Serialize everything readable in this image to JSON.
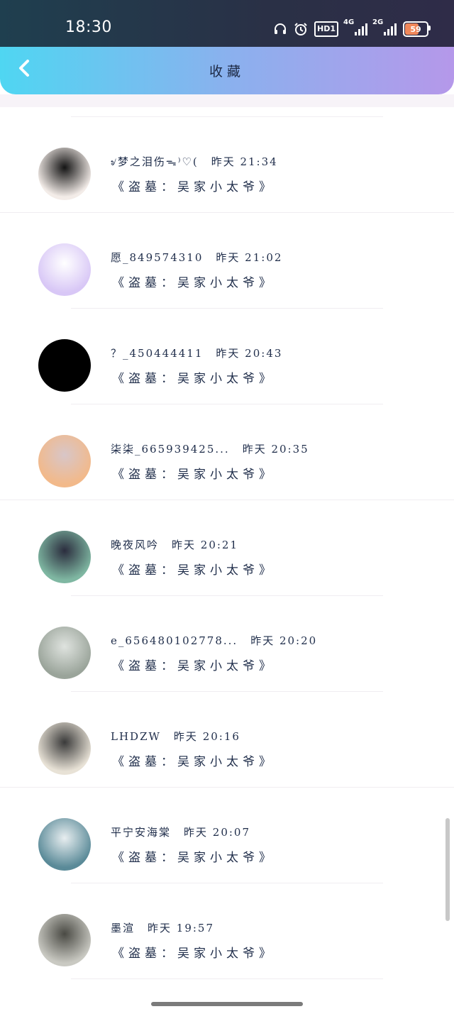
{
  "status_bar": {
    "time": "18:30",
    "icons": [
      "headphones-icon",
      "alarm-icon",
      "hd-icon",
      "signal-4g-icon",
      "signal-2g-icon",
      "battery-icon"
    ],
    "hd_label": "HD1",
    "net1_label": "4G",
    "net2_label": "2G",
    "battery_level": "59"
  },
  "header": {
    "title": "收藏",
    "back_icon": "chevron-left-icon"
  },
  "list": {
    "items": [
      {
        "name": "৶梦之泪伤ᯓ⁾♡(",
        "time": "昨天 21:34",
        "content": "《盗墓：吴家小太爷》",
        "avatar_colors": [
          "#f3ece8",
          "#141414"
        ]
      },
      {
        "name": "愿_849574310",
        "time": "昨天 21:02",
        "content": "《盗墓：吴家小太爷》",
        "avatar_colors": [
          "#d8c7f6",
          "#ffffff"
        ]
      },
      {
        "name": "？_450444411",
        "time": "昨天 20:43",
        "content": "《盗墓：吴家小太爷》",
        "avatar_colors": [
          "#000000",
          "#000000"
        ]
      },
      {
        "name": "柒柒_665939425...",
        "time": "昨天 20:35",
        "content": "《盗墓：吴家小太爷》",
        "avatar_colors": [
          "#f2b98a",
          "#d8c6c8"
        ]
      },
      {
        "name": "晚夜风吟",
        "time": "昨天 20:21",
        "content": "《盗墓：吴家小太爷》",
        "avatar_colors": [
          "#7fb7a2",
          "#2b2d3e"
        ]
      },
      {
        "name": "e_656480102778...",
        "time": "昨天 20:20",
        "content": "《盗墓：吴家小太爷》",
        "avatar_colors": [
          "#9aa49a",
          "#dfe3df"
        ]
      },
      {
        "name": "LHDZW",
        "time": "昨天 20:16",
        "content": "《盗墓：吴家小太爷》",
        "avatar_colors": [
          "#e8e2d6",
          "#3a3a3a"
        ]
      },
      {
        "name": "平宁安海棠",
        "time": "昨天 20:07",
        "content": "《盗墓：吴家小太爷》",
        "avatar_colors": [
          "#5a8a98",
          "#e8eef0"
        ]
      },
      {
        "name": "墨渲",
        "time": "昨天 19:57",
        "content": "《盗墓：吴家小太爷》",
        "avatar_colors": [
          "#c9c9c2",
          "#4a4a44"
        ]
      }
    ]
  }
}
